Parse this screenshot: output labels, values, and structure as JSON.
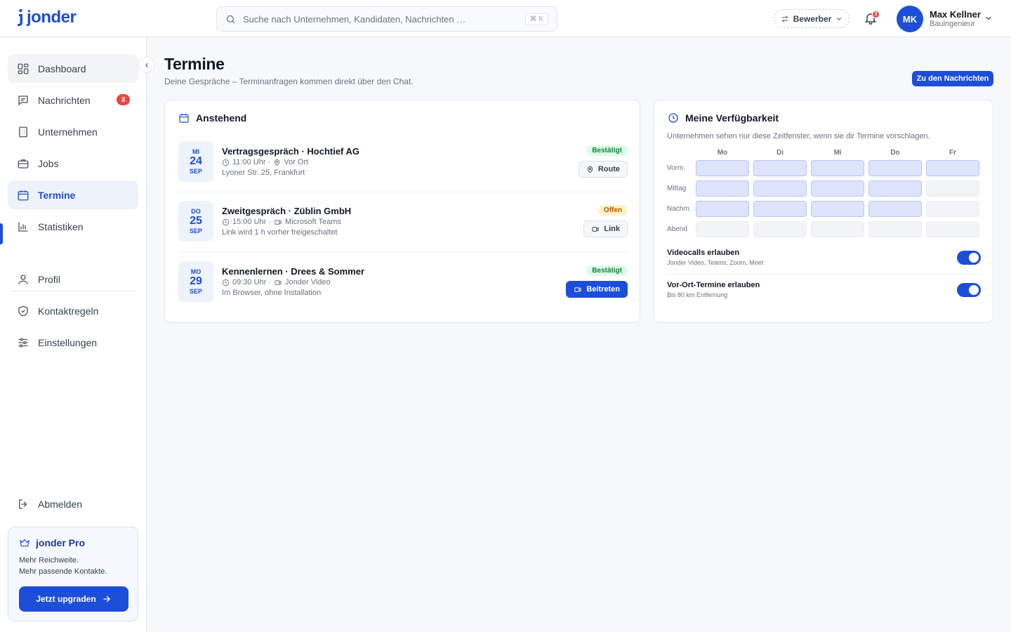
{
  "brand": {
    "name": "jonder",
    "accent": "#1d4ed8"
  },
  "header": {
    "search_placeholder": "Suche nach Unternehmen, Kandidaten, Nachrichten …",
    "search_shortcut": "⌘ K",
    "role_label": "Bewerber",
    "notification_count": "3",
    "user": {
      "initials": "MK",
      "name": "Max Kellner",
      "role": "Bauingenieur"
    }
  },
  "sidebar": {
    "items": [
      {
        "label": "Dashboard",
        "icon": "dashboard-icon"
      },
      {
        "label": "Nachrichten",
        "icon": "message-icon",
        "badge": "3"
      },
      {
        "label": "Unternehmen",
        "icon": "building-icon"
      },
      {
        "label": "Jobs",
        "icon": "briefcase-icon"
      },
      {
        "label": "Termine",
        "icon": "calendar-icon",
        "active": true
      },
      {
        "label": "Statistiken",
        "icon": "chart-icon"
      }
    ],
    "secondary": [
      {
        "label": "Profil",
        "icon": "user-icon"
      },
      {
        "label": "Kontaktregeln",
        "icon": "shield-icon"
      },
      {
        "label": "Einstellungen",
        "icon": "sliders-icon"
      }
    ],
    "logout_label": "Abmelden",
    "pro": {
      "title": "jonder Pro",
      "line1": "Mehr Reichweite.",
      "line2": "Mehr passende Kontakte.",
      "button": "Jetzt upgraden"
    }
  },
  "page": {
    "title": "Termine",
    "subtitle": "Deine Gespräche – Terminanfragen kommen direkt über den Chat.",
    "messages_button": "Zu den Nachrichten"
  },
  "upcoming": {
    "title": "Anstehend",
    "appointments": [
      {
        "dow": "MI",
        "day": "24",
        "month": "SEP",
        "title": "Vertragsgespräch · Hochtief AG",
        "time": "11:00 Uhr ·",
        "mode": "Vor Ort",
        "mode_icon": "pin-icon",
        "note": "Lyoner Str. 25, Frankfurt",
        "status": "Bestätigt",
        "status_type": "confirmed",
        "action": "Route",
        "action_icon": "pin-icon"
      },
      {
        "dow": "DO",
        "day": "25",
        "month": "SEP",
        "title": "Zweitgespräch · Züblin GmbH",
        "time": "15:00 Uhr ·",
        "mode": "Microsoft Teams",
        "mode_icon": "video-icon",
        "note": "Link wird 1 h vorher freigeschaltet",
        "status": "Offen",
        "status_type": "open",
        "action": "Link",
        "action_icon": "video-icon"
      },
      {
        "dow": "MO",
        "day": "29",
        "month": "SEP",
        "title": "Kennenlernen · Drees & Sommer",
        "time": "09:30 Uhr ·",
        "mode": "Jonder Video",
        "mode_icon": "video-icon",
        "note": "Im Browser, ohne Installation",
        "status": "Bestätigt",
        "status_type": "confirmed",
        "action": "Beitreten",
        "action_icon": "video-icon"
      }
    ]
  },
  "availability": {
    "title": "Meine Verfügbarkeit",
    "description": "Unternehmen sehen nur diese Zeitfenster, wenn sie dir Termine vorschlagen.",
    "days": [
      "Mo",
      "Di",
      "Mi",
      "Do",
      "Fr"
    ],
    "slots": [
      "Vorm.",
      "Mittag",
      "Nachm.",
      "Abend"
    ],
    "grid": [
      [
        true,
        true,
        true,
        true,
        true
      ],
      [
        true,
        true,
        true,
        true,
        false
      ],
      [
        true,
        true,
        true,
        true,
        false
      ],
      [
        false,
        false,
        false,
        false,
        false
      ]
    ],
    "toggles": [
      {
        "title": "Videocalls erlauben",
        "subtitle": "Jonder Video, Teams, Zoom, Meet",
        "on": true
      },
      {
        "title": "Vor-Ort-Termine erlauben",
        "subtitle": "Bis 80 km Entfernung",
        "on": true
      }
    ]
  }
}
